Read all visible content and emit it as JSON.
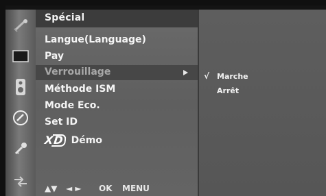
{
  "menu": {
    "title": "Spécial",
    "items": [
      {
        "label": "Langue(Language)",
        "selected": false
      },
      {
        "label": "Pay",
        "selected": false
      },
      {
        "label": "Verrouillage",
        "selected": true
      },
      {
        "label": "Méthode ISM",
        "selected": false
      },
      {
        "label": "Mode Eco.",
        "selected": false
      },
      {
        "label": "Set ID",
        "selected": false
      },
      {
        "label": "Démo",
        "selected": false,
        "logo": "XD"
      }
    ],
    "footer": {
      "nav_arrows_ud": "▲▼",
      "nav_arrows_lr": "◄ ►",
      "ok": "OK",
      "menu": "MENU"
    }
  },
  "submenu": {
    "check": "√",
    "options": [
      {
        "label": "Marche",
        "checked": true
      },
      {
        "label": "Arrêt",
        "checked": false
      }
    ]
  },
  "icons": [
    "settings-icon",
    "screen-icon",
    "audio-icon",
    "clock-icon",
    "key-icon",
    "special-icon"
  ],
  "colors": {
    "panel": "#646464",
    "header": "#3c3c3c",
    "highlight": "#474747",
    "text": "#f4f4f4"
  }
}
